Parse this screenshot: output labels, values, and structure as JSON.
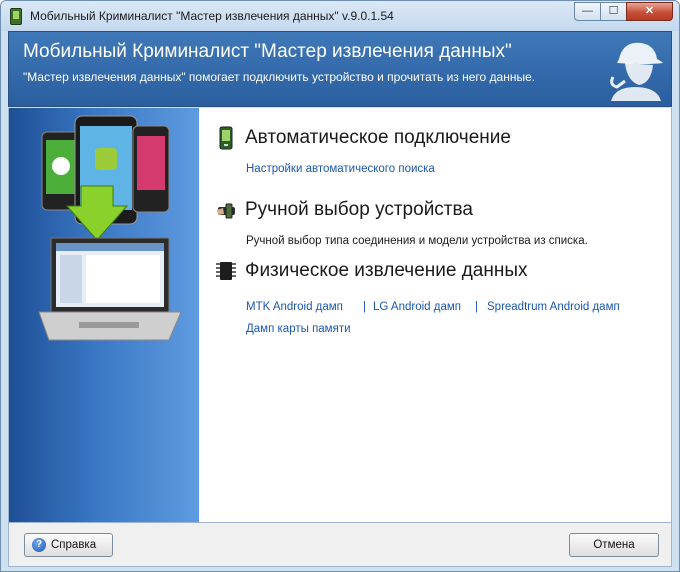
{
  "window": {
    "title": "Мобильный Криминалист \"Мастер извлечения данных\" v.9.0.1.54",
    "minimize_glyph": "—",
    "maximize_glyph": "☐",
    "close_glyph": "✕"
  },
  "header": {
    "title": "Мобильный Криминалист \"Мастер извлечения данных\"",
    "subtitle": "\"Мастер извлечения данных\" помогает подключить устройство и прочитать из него данные."
  },
  "sections": {
    "auto": {
      "icon": "phone-icon",
      "title": "Автоматическое подключение",
      "link": "Настройки автоматического поиска"
    },
    "manual": {
      "icon": "hand-device-icon",
      "title": "Ручной выбор устройства",
      "description": "Ручной выбор типа соединения и модели устройства из списка."
    },
    "physical": {
      "icon": "chip-icon",
      "title": "Физическое извлечение данных",
      "links": [
        "MTK Android дамп",
        "LG Android дамп",
        "Spreadtrum Android дамп",
        "Дамп карты памяти"
      ],
      "separator": "|"
    }
  },
  "footer": {
    "help_label": "Справка",
    "help_glyph": "?",
    "cancel_label": "Отмена"
  },
  "colors": {
    "header_bg": "#3f78b8",
    "link": "#1a56b0",
    "side_panel": "#2e67b3"
  }
}
